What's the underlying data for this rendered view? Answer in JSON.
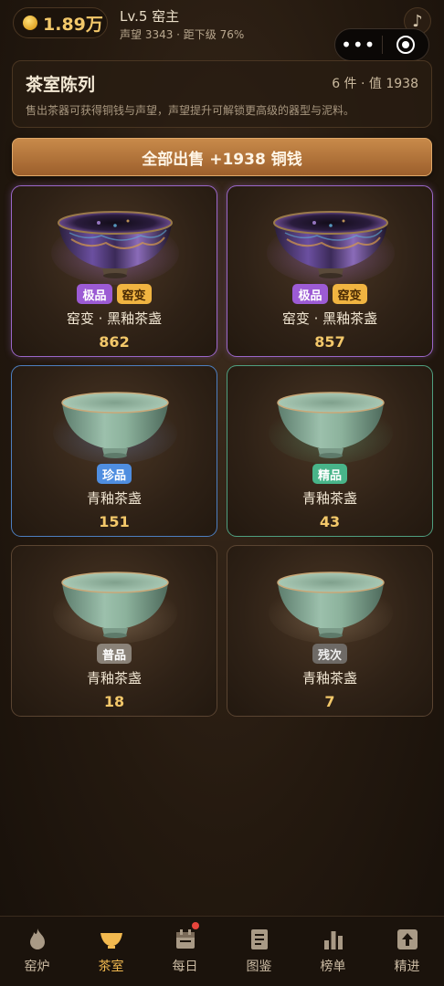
{
  "header": {
    "coin_amount": "1.89万",
    "level_title": "Lv.5 窑主",
    "level_sub": "声望 3343 · 距下级 76%",
    "music_icon": "♪"
  },
  "info": {
    "title": "茶室陈列",
    "stats": "6 件 · 值 1938",
    "desc": "售出茶器可获得铜钱与声望，声望提升可解锁更高级的器型与泥料。"
  },
  "sell_all_label": "全部出售 +1938 铜钱",
  "items": [
    {
      "badge1": "极品",
      "badge2": "窑变",
      "name": "窑变 · 黑釉茶盏",
      "price": "862",
      "tier": "epic",
      "glaze": "tenmoku"
    },
    {
      "badge1": "极品",
      "badge2": "窑变",
      "name": "窑变 · 黑釉茶盏",
      "price": "857",
      "tier": "epic",
      "glaze": "tenmoku"
    },
    {
      "badge1": "珍品",
      "name": "青釉茶盏",
      "price": "151",
      "tier": "rare",
      "glaze": "celadon"
    },
    {
      "badge1": "精品",
      "name": "青釉茶盏",
      "price": "43",
      "tier": "good",
      "glaze": "celadon"
    },
    {
      "badge1": "普品",
      "name": "青釉茶盏",
      "price": "18",
      "tier": "common",
      "glaze": "celadon"
    },
    {
      "badge1": "残次",
      "name": "青釉茶盏",
      "price": "7",
      "tier": "defect",
      "glaze": "celadon"
    }
  ],
  "nav": [
    {
      "label": "窑炉",
      "icon": "flame-icon"
    },
    {
      "label": "茶室",
      "icon": "teacup-icon",
      "active": true
    },
    {
      "label": "每日",
      "icon": "calendar-icon",
      "badge": true
    },
    {
      "label": "图鉴",
      "icon": "book-icon"
    },
    {
      "label": "榜单",
      "icon": "bar-chart-icon"
    },
    {
      "label": "精进",
      "icon": "upgrade-icon"
    }
  ],
  "colors": {
    "accent_gold": "#f3c86a",
    "active_tab": "#f2b94f",
    "epic": "#9b67c9",
    "rare": "#4d7fc0",
    "good": "#4f9f80"
  }
}
